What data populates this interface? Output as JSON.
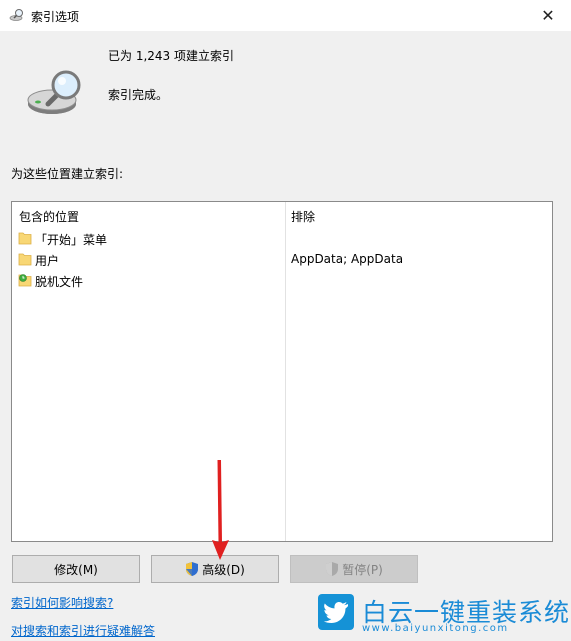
{
  "window": {
    "title": "索引选项",
    "close_glyph": "✕"
  },
  "status": {
    "count_text": "已为 1,243 项建立索引",
    "state_text": "索引完成。"
  },
  "section_label": "为这些位置建立索引:",
  "table": {
    "headers": [
      "包含的位置",
      "排除"
    ],
    "rows": [
      {
        "name": "「开始」菜单",
        "exclude": "",
        "icon": "folder-icon"
      },
      {
        "name": "用户",
        "exclude": "AppData; AppData",
        "icon": "folder-icon"
      },
      {
        "name": "脱机文件",
        "exclude": "",
        "icon": "offline-files-icon"
      }
    ]
  },
  "buttons": {
    "modify": "修改(M)",
    "advanced": "高级(D)",
    "pause": "暂停(P)"
  },
  "links": {
    "how_affects": "索引如何影响搜索?",
    "troubleshoot": "对搜索和索引进行疑难解答"
  },
  "watermark": {
    "text": "白云一键重装系统",
    "url": "www.baiyunxitong.com"
  },
  "colors": {
    "link": "#0066cc",
    "annotation_arrow": "#e02020",
    "watermark": "#1a8bd6"
  }
}
